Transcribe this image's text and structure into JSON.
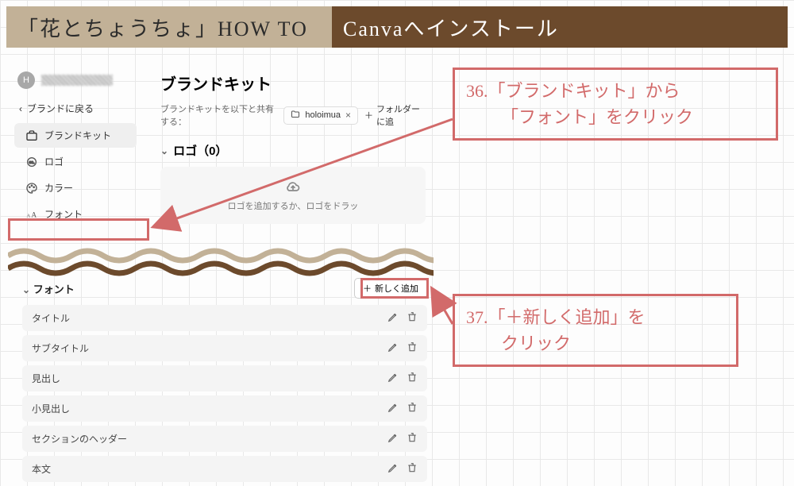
{
  "header": {
    "left": "「花とちょうちょ」HOW TO",
    "right": "Canvaへインストール"
  },
  "sidebar": {
    "avatar_letter": "H",
    "back_label": "ブランドに戻る",
    "items": [
      {
        "label": "ブランドキット",
        "active": true
      },
      {
        "label": "ロゴ",
        "active": false
      },
      {
        "label": "カラー",
        "active": false
      },
      {
        "label": "フォント",
        "active": false
      }
    ]
  },
  "content": {
    "title": "ブランドキット",
    "share_prefix": "ブランドキットを以下と共有する：",
    "share_chip": "holoimua",
    "add_folder": "フォルダーに追",
    "logo_section": "ロゴ（0）",
    "logo_hint": "ロゴを追加するか、ロゴをドラッ"
  },
  "fonts": {
    "section_label": "フォント",
    "add_new_label": "新しく追加",
    "rows": [
      "タイトル",
      "サブタイトル",
      "見出し",
      "小見出し",
      "セクションのヘッダー",
      "本文"
    ]
  },
  "callouts": {
    "c1_line1": "36.「ブランドキット」から",
    "c1_line2": "「フォント」をクリック",
    "c2_line1": "37.「＋新しく追加」を",
    "c2_line2": "クリック"
  }
}
